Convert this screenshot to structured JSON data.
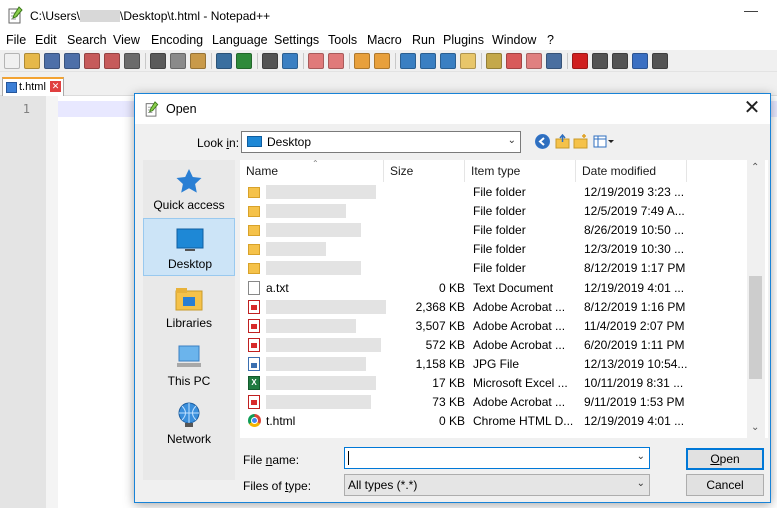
{
  "app": {
    "title_prefix": "C:\\Users\\",
    "title_suffix": "\\Desktop\\t.html - Notepad++",
    "minimize": "—"
  },
  "menu": [
    "File",
    "Edit",
    "Search",
    "View",
    "Encoding",
    "Language",
    "Settings",
    "Tools",
    "Macro",
    "Run",
    "Plugins",
    "Window",
    "?"
  ],
  "toolbar_icons": [
    {
      "name": "new-file-icon",
      "color": "#f0f0f0"
    },
    {
      "name": "open-file-icon",
      "color": "#e6b84a"
    },
    {
      "name": "save-icon",
      "color": "#4d6fa8"
    },
    {
      "name": "save-all-icon",
      "color": "#4d6fa8"
    },
    {
      "name": "close-icon",
      "color": "#c65a5a"
    },
    {
      "name": "close-all-icon",
      "color": "#c65a5a"
    },
    {
      "name": "print-icon",
      "color": "#6b6b6b"
    },
    {
      "name": "cut-icon",
      "color": "#5a5a5a"
    },
    {
      "name": "copy-icon",
      "color": "#8a8a8a"
    },
    {
      "name": "paste-icon",
      "color": "#c99a4a"
    },
    {
      "name": "undo-icon",
      "color": "#3a6f9f"
    },
    {
      "name": "redo-icon",
      "color": "#2f8a3a"
    },
    {
      "name": "find-icon",
      "color": "#555555"
    },
    {
      "name": "replace-icon",
      "color": "#3a7fc2"
    },
    {
      "name": "zoom-in-icon",
      "color": "#e07a7a"
    },
    {
      "name": "zoom-out-icon",
      "color": "#e07a7a"
    },
    {
      "name": "sync-v-icon",
      "color": "#e8a03c"
    },
    {
      "name": "sync-h-icon",
      "color": "#e8a03c"
    },
    {
      "name": "word-wrap-icon",
      "color": "#3a7fc2"
    },
    {
      "name": "show-all-chars-icon",
      "color": "#3a7fc2"
    },
    {
      "name": "indent-guide-icon",
      "color": "#3a7fc2"
    },
    {
      "name": "doc-map-icon",
      "color": "#e8c66a"
    },
    {
      "name": "function-list-icon",
      "color": "#c4a84a"
    },
    {
      "name": "folder-workspace-icon",
      "color": "#d85a5a"
    },
    {
      "name": "monitoring-icon",
      "color": "#e08080"
    },
    {
      "name": "eye-icon",
      "color": "#4a6fa0"
    },
    {
      "name": "record-macro-icon",
      "color": "#d02020"
    },
    {
      "name": "stop-macro-icon",
      "color": "#555555"
    },
    {
      "name": "play-macro-icon",
      "color": "#555555"
    },
    {
      "name": "run-macro-multiple-icon",
      "color": "#3a6fc2"
    },
    {
      "name": "save-macro-icon",
      "color": "#555555"
    }
  ],
  "tab": {
    "label": "t.html",
    "close": "✕"
  },
  "editor": {
    "line_number": "1"
  },
  "dialog": {
    "title": "Open",
    "close": "✕",
    "look_in_label": "Look in:",
    "look_in_value": "Desktop",
    "places": [
      "Quick access",
      "Desktop",
      "Libraries",
      "This PC",
      "Network"
    ],
    "columns": [
      "Name",
      "Size",
      "Item type",
      "Date modified"
    ],
    "files": [
      {
        "name": "",
        "size": "",
        "type": "File folder",
        "date": "12/19/2019 3:23 ...",
        "icon": "folder"
      },
      {
        "name": "",
        "size": "",
        "type": "File folder",
        "date": "12/5/2019 7:49 A...",
        "icon": "folder"
      },
      {
        "name": "",
        "size": "",
        "type": "File folder",
        "date": "8/26/2019 10:50 ...",
        "icon": "folder"
      },
      {
        "name": "",
        "size": "",
        "type": "File folder",
        "date": "12/3/2019 10:30 ...",
        "icon": "folder"
      },
      {
        "name": "",
        "size": "",
        "type": "File folder",
        "date": "8/12/2019 1:17 PM",
        "icon": "folder"
      },
      {
        "name": "a.txt",
        "size": "0 KB",
        "type": "Text Document",
        "date": "12/19/2019 4:01 ...",
        "icon": "txt"
      },
      {
        "name": "",
        "size": "2,368 KB",
        "type": "Adobe Acrobat ...",
        "date": "8/12/2019 1:16 PM",
        "icon": "pdf"
      },
      {
        "name": "",
        "size": "3,507 KB",
        "type": "Adobe Acrobat ...",
        "date": "11/4/2019 2:07 PM",
        "icon": "pdf"
      },
      {
        "name": "",
        "size": "572 KB",
        "type": "Adobe Acrobat ...",
        "date": "6/20/2019 1:11 PM",
        "icon": "pdf"
      },
      {
        "name": "",
        "size": "1,158 KB",
        "type": "JPG File",
        "date": "12/13/2019 10:54...",
        "icon": "jpg"
      },
      {
        "name": "",
        "size": "17 KB",
        "type": "Microsoft Excel ...",
        "date": "10/11/2019 8:31 ...",
        "icon": "xls"
      },
      {
        "name": "",
        "size": "73 KB",
        "type": "Adobe Acrobat ...",
        "date": "9/11/2019 1:53 PM",
        "icon": "pdf"
      },
      {
        "name": "t.html",
        "size": "0 KB",
        "type": "Chrome HTML D...",
        "date": "12/19/2019 4:01 ...",
        "icon": "chrome"
      }
    ],
    "file_name_label": "File name:",
    "file_name_value": "",
    "files_of_type_label": "Files of type:",
    "files_of_type_value": "All types (*.*)",
    "open_button": "Open",
    "cancel_button": "Cancel"
  }
}
